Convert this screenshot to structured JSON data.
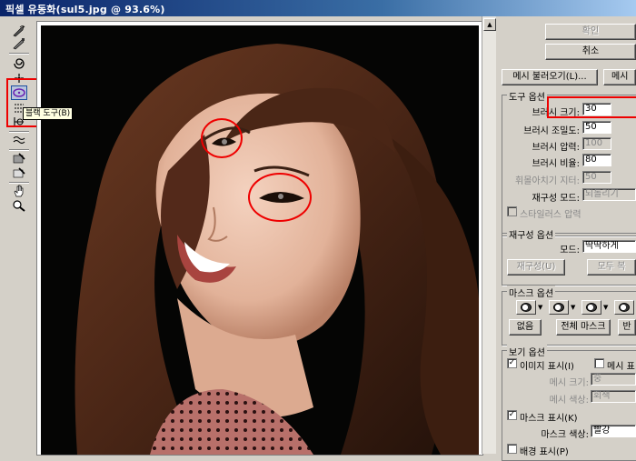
{
  "window": {
    "title": "픽셀 유동화(sul5.jpg @ 93.6%)"
  },
  "tooltip": {
    "text": "블랙 도구(B)"
  },
  "tools": [
    {
      "icon": "forward-warp-icon"
    },
    {
      "icon": "reconstruct-icon"
    },
    {
      "icon": "twirl-icon"
    },
    {
      "icon": "pucker-icon"
    },
    {
      "icon": "bloat-icon"
    },
    {
      "icon": "push-left-icon"
    },
    {
      "icon": "mirror-icon"
    },
    {
      "icon": "turbulence-icon"
    },
    {
      "icon": "freeze-mask-icon"
    },
    {
      "icon": "thaw-mask-icon"
    },
    {
      "icon": "hand-icon"
    },
    {
      "icon": "zoom-icon"
    }
  ],
  "buttons": {
    "ok": "확인",
    "cancel": "취소",
    "load_mesh": "메시 불러오기(L)...",
    "save_mesh": "메시"
  },
  "tool_options": {
    "title": "도구 옵션",
    "brush_size": {
      "label": "브러시 크기:",
      "value": "30"
    },
    "brush_density": {
      "label": "브러시 조밀도:",
      "value": "50"
    },
    "brush_pressure": {
      "label": "브러시 압력:",
      "value": "100"
    },
    "brush_rate": {
      "label": "브러시 비율:",
      "value": "80"
    },
    "turbulent_jitter": {
      "label": "휘몰아치기 지터:",
      "value": "50"
    },
    "reconstruct_mode": {
      "label": "재구성 모드:",
      "value": "되돌리기"
    },
    "stylus_pressure": {
      "label": "스타일러스 압력",
      "checked": false
    }
  },
  "reconstruct_options": {
    "title": "재구성 옵션",
    "mode": {
      "label": "모드:",
      "value": "딱딱하게"
    },
    "reconstruct_button": "재구성(U)",
    "restore_all_button": "모두 복"
  },
  "mask_options": {
    "title": "마스크 옵션",
    "none_button": "없음",
    "mask_all_button": "전체 마스크",
    "invert_button": "반"
  },
  "view_options": {
    "title": "보기 옵션",
    "show_image": {
      "label": "이미지 표시(I)",
      "checked": true
    },
    "show_mesh": {
      "label": "메시 표",
      "checked": false
    },
    "mesh_size": {
      "label": "메시 크기:",
      "value": "중"
    },
    "mesh_color": {
      "label": "메시 색상:",
      "value": "회색"
    },
    "show_mask": {
      "label": "마스크 표시(K)",
      "checked": true
    },
    "mask_color": {
      "label": "마스크 색상:",
      "value": "빨강"
    },
    "show_backdrop": {
      "label": "배경 표시(P)",
      "checked": false
    }
  },
  "colors": {
    "annotation": "#e00000",
    "title_bar": "#0a246a",
    "dialog_bg": "#d4d0c8"
  }
}
